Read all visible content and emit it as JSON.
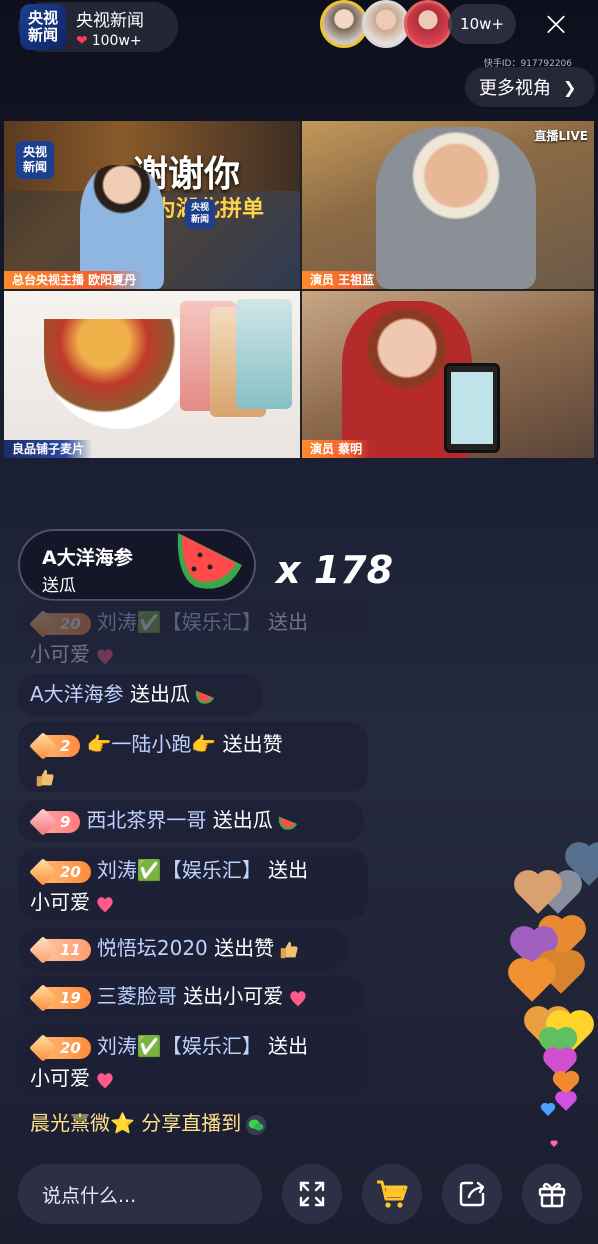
{
  "header": {
    "channel_logo_line1": "央视",
    "channel_logo_line2": "新闻",
    "channel_name": "央视新闻",
    "likes": "100w+",
    "viewer_count": "10w+",
    "close_label": "×",
    "kuaishou_id": "快手ID：917792206",
    "more_views_label": "更多视角"
  },
  "video": {
    "tile1_caption": "总台央视主播 欧阳夏丹",
    "tile1_banner_main": "谢谢你",
    "tile1_banner_sub": "为湖北拼单",
    "tile1_logo_line1": "央视",
    "tile1_logo_line2": "新闻",
    "tile1_logo2_line1": "央视",
    "tile1_logo2_line2": "新闻",
    "tile2_caption": "演员 王祖蓝",
    "tile2_live": "直播LIVE",
    "tile3_caption": "良品铺子麦片",
    "tile4_caption": "演员 蔡明"
  },
  "gift_banner": {
    "name": "A大洋海参",
    "action": "送瓜",
    "combo": "x 178"
  },
  "chat": [
    {
      "badge": "20",
      "user": "刘涛✅【娱乐汇】",
      "text": "送出",
      "line2": "小可爱",
      "faded": true
    },
    {
      "user": "A大洋海参",
      "text": "送出瓜"
    },
    {
      "badge": "2",
      "user": "👉一陆小跑👉",
      "text": "送出赞"
    },
    {
      "badge": "9",
      "user": "西北茶界一哥",
      "text": "送出瓜"
    },
    {
      "badge": "20",
      "user": "刘涛✅【娱乐汇】",
      "text": "送出",
      "line2": "小可爱"
    },
    {
      "badge": "11",
      "user": "悦悟坛2020",
      "text": "送出赞"
    },
    {
      "badge": "19",
      "user": "三菱脸哥",
      "text": "送出小可爱"
    },
    {
      "badge": "20",
      "user": "刘涛✅【娱乐汇】",
      "text": "送出",
      "line2": "小可爱"
    },
    {
      "user": "晨光熹微⭐",
      "text": "分享直播到"
    }
  ],
  "bottom": {
    "input_placeholder": "说点什么...",
    "icons": [
      "fullscreen-icon",
      "shopping-cart-icon",
      "share-icon",
      "gift-icon"
    ]
  },
  "colors": {
    "accent_orange": "#ff8a2b",
    "cart_yellow": "#ffc42a",
    "chat_user": "#bcd2ff"
  }
}
